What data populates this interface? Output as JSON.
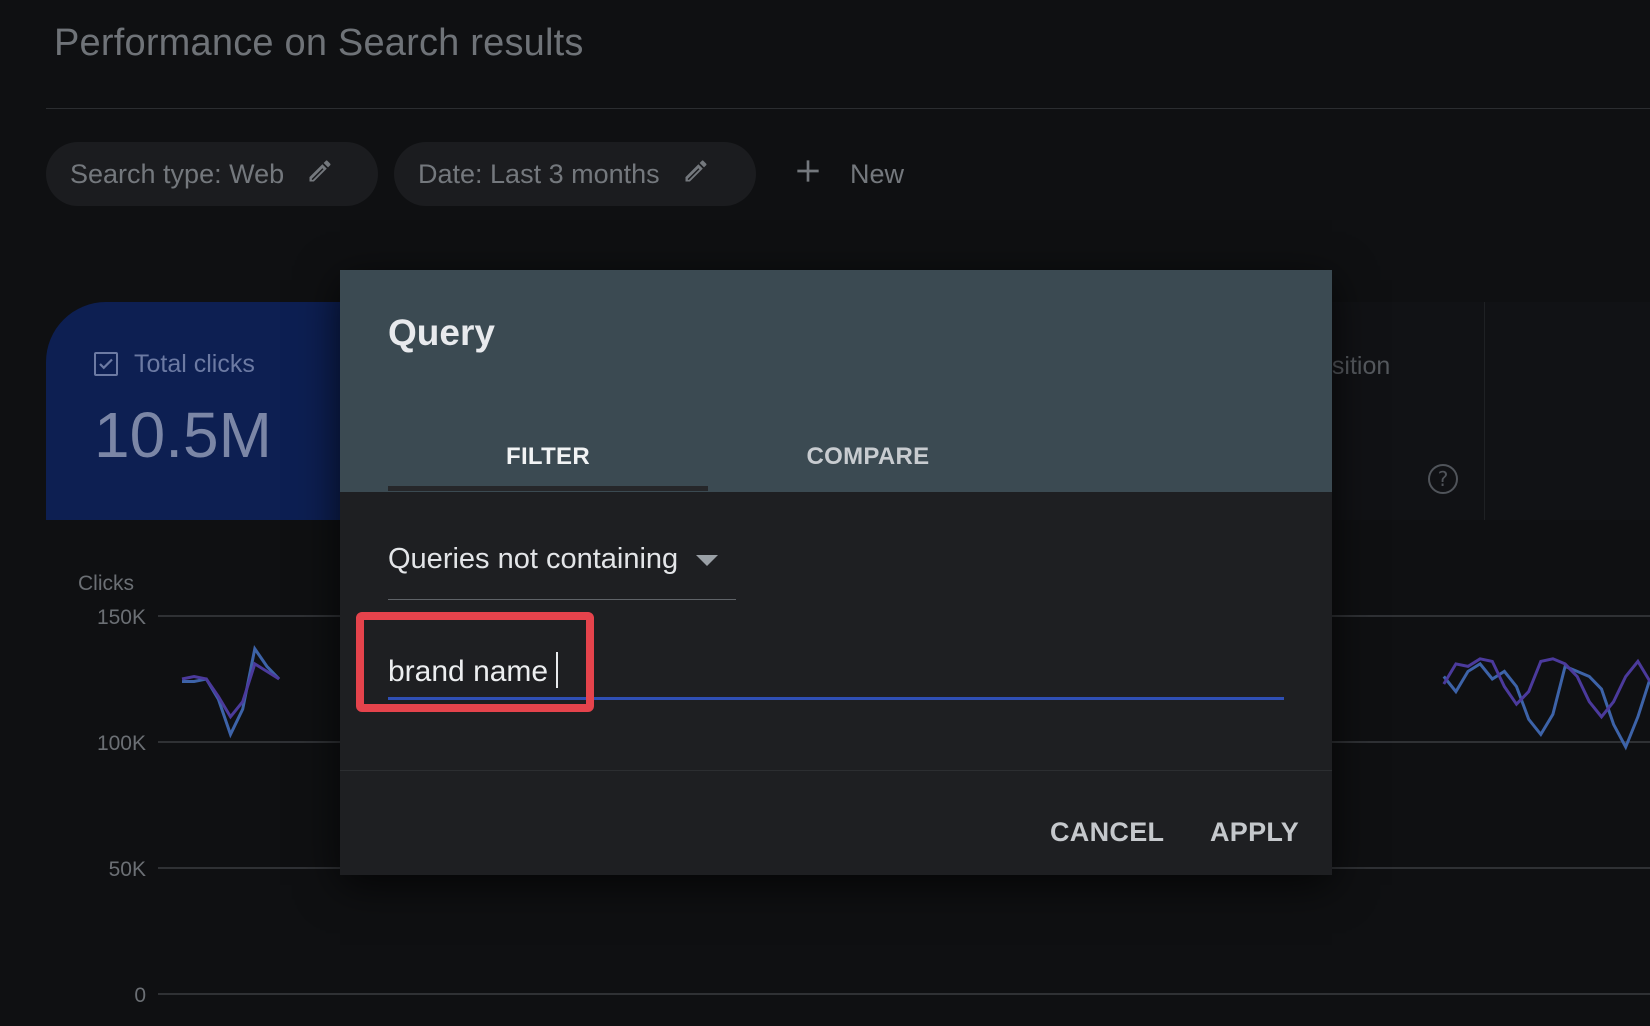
{
  "page": {
    "title": "Performance on Search results"
  },
  "filters": {
    "search_type": "Search type: Web",
    "date": "Date: Last 3 months",
    "new_label": "New"
  },
  "metrics": {
    "total_clicks": {
      "label": "Total clicks",
      "value": "10.5M",
      "checked": true
    },
    "position_label_partial": "osition"
  },
  "dialog": {
    "title": "Query",
    "tabs": [
      {
        "label": "FILTER",
        "active": true
      },
      {
        "label": "COMPARE",
        "active": false
      }
    ],
    "operator": "Queries not containing",
    "input_value": "brand name",
    "cancel_label": "CANCEL",
    "apply_label": "APPLY"
  },
  "colors": {
    "accent_blue": "#2f4fb5",
    "highlight_red": "#e5434c",
    "series_clicks": "#3d63a8",
    "series_compare": "#4b3a9c"
  },
  "chart_data": {
    "type": "line",
    "ylabel": "Clicks",
    "yticks": [
      "150K",
      "100K",
      "50K",
      "0"
    ],
    "ytick_values": [
      150000,
      100000,
      50000,
      0
    ],
    "ylim": [
      0,
      150000
    ],
    "grid": true,
    "series": [
      {
        "values": [
          124000,
          124000,
          125000,
          117000,
          103000,
          113000,
          137000,
          130000,
          125000,
          null,
          null,
          null,
          null,
          null,
          null,
          null,
          null,
          null,
          null,
          null,
          null,
          null,
          null,
          null,
          null,
          null,
          null,
          null,
          null,
          null,
          null,
          null,
          null,
          null,
          null,
          null,
          null,
          null,
          null,
          null,
          null,
          null,
          null,
          null,
          null,
          null,
          null,
          null,
          null,
          null,
          null,
          null,
          null,
          null,
          null,
          null,
          null,
          null,
          null,
          null,
          null,
          null,
          null,
          null,
          null,
          null,
          null,
          null,
          null,
          null,
          null,
          null,
          null,
          null,
          null,
          null,
          null,
          null,
          null,
          null,
          null,
          null,
          null,
          null,
          null,
          null,
          null,
          null,
          null,
          null,
          null,
          null,
          null,
          null,
          null,
          null,
          null,
          null,
          null,
          null,
          null,
          null,
          null,
          null,
          126000,
          120000,
          128000,
          131000,
          125000,
          128000,
          122000,
          109000,
          103000,
          111000,
          130000,
          128000,
          126000,
          121000,
          107000,
          98000,
          110000,
          125000
        ]
      },
      {
        "values": [
          125000,
          126000,
          125000,
          118000,
          110000,
          116000,
          131000,
          128000,
          125000,
          null,
          null,
          null,
          null,
          null,
          null,
          null,
          null,
          null,
          null,
          null,
          null,
          null,
          null,
          null,
          null,
          null,
          null,
          null,
          null,
          null,
          null,
          null,
          null,
          null,
          null,
          null,
          null,
          null,
          null,
          null,
          null,
          null,
          null,
          null,
          null,
          null,
          null,
          null,
          null,
          null,
          null,
          null,
          null,
          null,
          null,
          null,
          null,
          null,
          null,
          null,
          null,
          null,
          null,
          null,
          null,
          null,
          null,
          null,
          null,
          null,
          null,
          null,
          null,
          null,
          null,
          null,
          null,
          null,
          null,
          null,
          null,
          null,
          null,
          null,
          null,
          null,
          null,
          null,
          null,
          null,
          null,
          null,
          null,
          null,
          null,
          null,
          null,
          null,
          null,
          null,
          null,
          null,
          null,
          null,
          123000,
          131000,
          130000,
          133000,
          132000,
          122000,
          115000,
          120000,
          132000,
          133000,
          131000,
          126000,
          116000,
          110000,
          116000,
          126000,
          132000,
          124000
        ]
      }
    ]
  }
}
